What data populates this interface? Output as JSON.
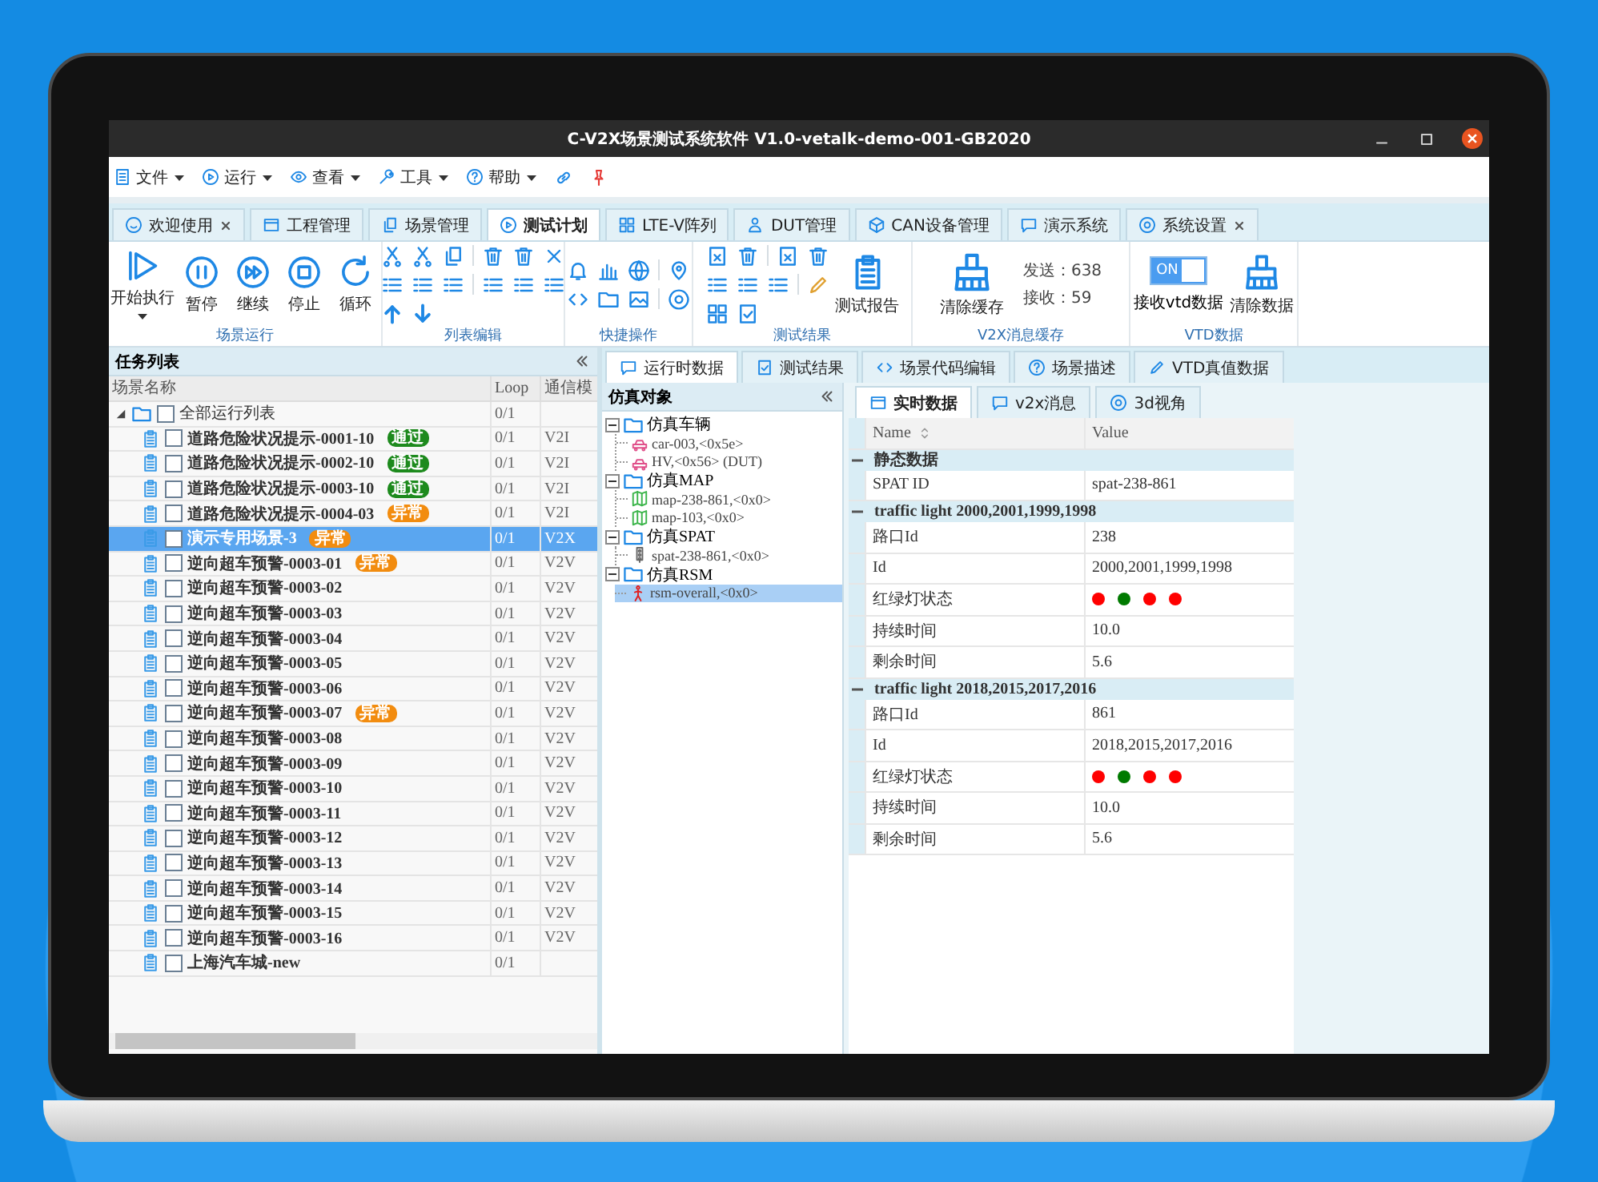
{
  "window": {
    "title": "C-V2X场景测试系统软件 V1.0-vetalk-demo-001-GB2020"
  },
  "menu": [
    {
      "label": "文件"
    },
    {
      "label": "运行"
    },
    {
      "label": "查看"
    },
    {
      "label": "工具"
    },
    {
      "label": "帮助"
    }
  ],
  "tabs": [
    {
      "label": "欢迎使用",
      "selected": false,
      "closable": true
    },
    {
      "label": "工程管理",
      "selected": false,
      "closable": false
    },
    {
      "label": "场景管理",
      "selected": false,
      "closable": false
    },
    {
      "label": "测试计划",
      "selected": true,
      "closable": false
    },
    {
      "label": "LTE-V阵列",
      "selected": false,
      "closable": false
    },
    {
      "label": "DUT管理",
      "selected": false,
      "closable": false
    },
    {
      "label": "CAN设备管理",
      "selected": false,
      "closable": false
    },
    {
      "label": "演示系统",
      "selected": false,
      "closable": false
    },
    {
      "label": "系统设置",
      "selected": false,
      "closable": true
    }
  ],
  "ribbon": [
    {
      "label": "场景运行",
      "kind": "run",
      "buttons": [
        {
          "label": "开始执行",
          "dropdown": true
        },
        {
          "label": "暂停",
          "dropdown": false
        },
        {
          "label": "继续",
          "dropdown": false
        },
        {
          "label": "停止",
          "dropdown": false
        },
        {
          "label": "循环",
          "dropdown": false
        }
      ]
    },
    {
      "label": "列表编辑",
      "kind": "list-edit"
    },
    {
      "label": "快捷操作",
      "kind": "quick"
    },
    {
      "label": "测试结果",
      "kind": "results",
      "buttons": [
        {
          "label": "测试报告"
        }
      ]
    },
    {
      "label": "V2X消息缓存",
      "kind": "cache",
      "buttons": [
        {
          "label": "清除缓存"
        }
      ],
      "counters": [
        "发送：638",
        "接收：59"
      ]
    },
    {
      "label": "VTD数据",
      "kind": "vtd",
      "toggle": {
        "text": "ON",
        "on": true,
        "label": "接收vtd数据"
      },
      "buttons": [
        {
          "label": "清除数据"
        }
      ]
    }
  ],
  "tasks": {
    "title": "任务列表",
    "columns": [
      "场景名称",
      "Loop",
      "通信模"
    ],
    "rows": [
      {
        "name": "全部运行列表",
        "loop": "0/1",
        "expanded": true,
        "checked": false,
        "selected": false,
        "children": [
          {
            "name": "道路危险状况提示-0001-10",
            "loop": "0/1",
            "comm": "V2I",
            "badge": {
              "text": "通过",
              "kind": "pass"
            },
            "checked": false,
            "selected": false
          },
          {
            "name": "道路危险状况提示-0002-10",
            "loop": "0/1",
            "comm": "V2I",
            "badge": {
              "text": "通过",
              "kind": "pass"
            },
            "checked": false,
            "selected": false
          },
          {
            "name": "道路危险状况提示-0003-10",
            "loop": "0/1",
            "comm": "V2I",
            "badge": {
              "text": "通过",
              "kind": "pass"
            },
            "checked": false,
            "selected": false
          },
          {
            "name": "道路危险状况提示-0004-03",
            "loop": "0/1",
            "comm": "V2I",
            "badge": {
              "text": "异常",
              "kind": "error"
            },
            "checked": false,
            "selected": false
          },
          {
            "name": "演示专用场景-3",
            "loop": "0/1",
            "comm": "V2X",
            "badge": {
              "text": "异常",
              "kind": "error"
            },
            "checked": false,
            "selected": true
          },
          {
            "name": "逆向超车预警-0003-01",
            "loop": "0/1",
            "comm": "V2V",
            "badge": {
              "text": "异常",
              "kind": "error"
            },
            "checked": false,
            "selected": false
          },
          {
            "name": "逆向超车预警-0003-02",
            "loop": "0/1",
            "comm": "V2V",
            "checked": false,
            "selected": false
          },
          {
            "name": "逆向超车预警-0003-03",
            "loop": "0/1",
            "comm": "V2V",
            "checked": false,
            "selected": false
          },
          {
            "name": "逆向超车预警-0003-04",
            "loop": "0/1",
            "comm": "V2V",
            "checked": false,
            "selected": false
          },
          {
            "name": "逆向超车预警-0003-05",
            "loop": "0/1",
            "comm": "V2V",
            "checked": false,
            "selected": false
          },
          {
            "name": "逆向超车预警-0003-06",
            "loop": "0/1",
            "comm": "V2V",
            "checked": false,
            "selected": false
          },
          {
            "name": "逆向超车预警-0003-07",
            "loop": "0/1",
            "comm": "V2V",
            "badge": {
              "text": "异常",
              "kind": "error"
            },
            "checked": false,
            "selected": false
          },
          {
            "name": "逆向超车预警-0003-08",
            "loop": "0/1",
            "comm": "V2V",
            "checked": false,
            "selected": false
          },
          {
            "name": "逆向超车预警-0003-09",
            "loop": "0/1",
            "comm": "V2V",
            "checked": false,
            "selected": false
          },
          {
            "name": "逆向超车预警-0003-10",
            "loop": "0/1",
            "comm": "V2V",
            "checked": false,
            "selected": false
          },
          {
            "name": "逆向超车预警-0003-11",
            "loop": "0/1",
            "comm": "V2V",
            "checked": false,
            "selected": false
          },
          {
            "name": "逆向超车预警-0003-12",
            "loop": "0/1",
            "comm": "V2V",
            "checked": false,
            "selected": false
          },
          {
            "name": "逆向超车预警-0003-13",
            "loop": "0/1",
            "comm": "V2V",
            "checked": false,
            "selected": false
          },
          {
            "name": "逆向超车预警-0003-14",
            "loop": "0/1",
            "comm": "V2V",
            "checked": false,
            "selected": false
          },
          {
            "name": "逆向超车预警-0003-15",
            "loop": "0/1",
            "comm": "V2V",
            "checked": false,
            "selected": false
          },
          {
            "name": "逆向超车预警-0003-16",
            "loop": "0/1",
            "comm": "V2V",
            "checked": false,
            "selected": false
          },
          {
            "name": "上海汽车城-new",
            "loop": "0/1",
            "checked": false,
            "selected": false
          }
        ]
      }
    ]
  },
  "right_tabs": [
    {
      "label": "运行时数据",
      "selected": true
    },
    {
      "label": "测试结果",
      "selected": false
    },
    {
      "label": "场景代码编辑",
      "selected": false
    },
    {
      "label": "场景描述",
      "selected": false
    },
    {
      "label": "VTD真值数据",
      "selected": false
    }
  ],
  "object_tree": {
    "title": "仿真对象",
    "groups": [
      {
        "label": "仿真车辆",
        "expanded": true,
        "children": [
          {
            "label": "car-003,<0x5e>",
            "kind": "car",
            "selected": false
          },
          {
            "label": "HV,<0x56> (DUT)",
            "kind": "car",
            "selected": false
          }
        ]
      },
      {
        "label": "仿真MAP",
        "expanded": true,
        "children": [
          {
            "label": "map-238-861,<0x0>",
            "kind": "map",
            "selected": false
          },
          {
            "label": "map-103,<0x0>",
            "kind": "map",
            "selected": false
          }
        ]
      },
      {
        "label": "仿真SPAT",
        "expanded": true,
        "children": [
          {
            "label": "spat-238-861,<0x0>",
            "kind": "light",
            "selected": false
          }
        ]
      },
      {
        "label": "仿真RSM",
        "expanded": true,
        "children": [
          {
            "label": "rsm-overall,<0x0>",
            "kind": "person",
            "selected": true
          }
        ]
      }
    ]
  },
  "sub_tabs": [
    {
      "label": "实时数据",
      "selected": true
    },
    {
      "label": "v2x消息",
      "selected": false
    },
    {
      "label": "3d视角",
      "selected": false
    }
  ],
  "properties": {
    "columns": [
      "Name",
      "Value"
    ],
    "sections": [
      {
        "title": "静态数据",
        "expanded": true,
        "rows": [
          {
            "kind": "text",
            "name": "SPAT ID",
            "value": "spat-238-861"
          }
        ]
      },
      {
        "title": "traffic light 2000,2001,1999,1998",
        "expanded": true,
        "rows": [
          {
            "kind": "text",
            "name": "路口Id",
            "value": "238"
          },
          {
            "kind": "text",
            "name": "Id",
            "value": "2000,2001,1999,1998"
          },
          {
            "kind": "lights",
            "name": "红绿灯状态",
            "lights": [
              {
                "color": "#ff0000"
              },
              {
                "color": "#007a00"
              },
              {
                "color": "#ff0000"
              },
              {
                "color": "#ff0000"
              }
            ]
          },
          {
            "kind": "text",
            "name": "持续时间",
            "value": "10.0"
          },
          {
            "kind": "text",
            "name": "剩余时间",
            "value": "5.6"
          }
        ]
      },
      {
        "title": "traffic light 2018,2015,2017,2016",
        "expanded": true,
        "rows": [
          {
            "kind": "text",
            "name": "路口Id",
            "value": "861"
          },
          {
            "kind": "text",
            "name": "Id",
            "value": "2018,2015,2017,2016"
          },
          {
            "kind": "lights",
            "name": "红绿灯状态",
            "lights": [
              {
                "color": "#ff0000"
              },
              {
                "color": "#007a00"
              },
              {
                "color": "#ff0000"
              },
              {
                "color": "#ff0000"
              }
            ]
          },
          {
            "kind": "text",
            "name": "持续时间",
            "value": "10.0"
          },
          {
            "kind": "text",
            "name": "剩余时间",
            "value": "5.6"
          }
        ]
      }
    ]
  }
}
